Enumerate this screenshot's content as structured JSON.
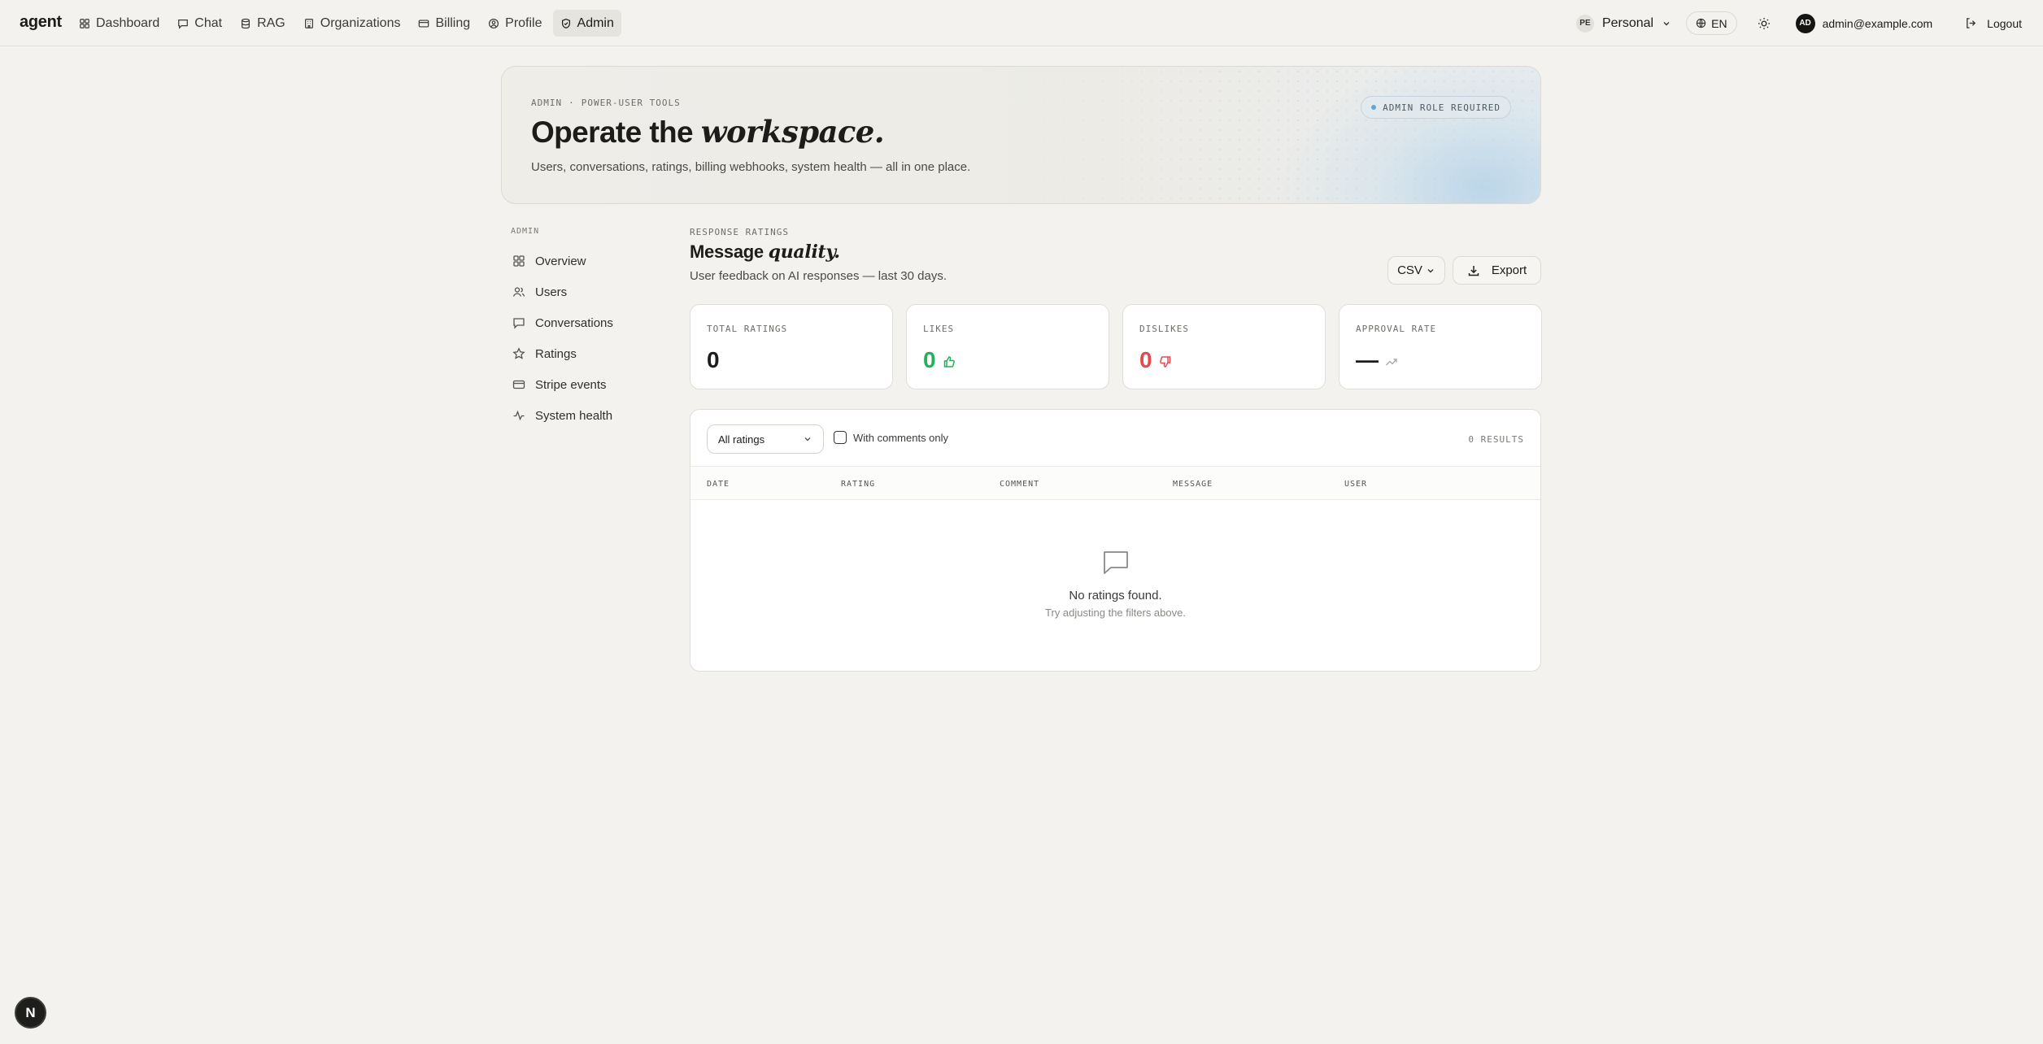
{
  "app": {
    "brand": "agent"
  },
  "nav": {
    "items": [
      {
        "label": "Dashboard",
        "icon": "dashboard-icon"
      },
      {
        "label": "Chat",
        "icon": "chat-icon"
      },
      {
        "label": "RAG",
        "icon": "database-icon"
      },
      {
        "label": "Organizations",
        "icon": "building-icon"
      },
      {
        "label": "Billing",
        "icon": "card-icon"
      },
      {
        "label": "Profile",
        "icon": "user-circle-icon"
      },
      {
        "label": "Admin",
        "icon": "shield-icon",
        "active": true
      }
    ],
    "org": {
      "initials": "PE",
      "name": "Personal"
    },
    "language": "EN",
    "user": {
      "initials": "AD",
      "email": "admin@example.com"
    },
    "logout_label": "Logout"
  },
  "hero": {
    "eyebrow_a": "ADMIN",
    "eyebrow_sep": "·",
    "eyebrow_b": "POWER-USER TOOLS",
    "title_plain": "Operate the ",
    "title_em": "workspace.",
    "subtitle": "Users, conversations, ratings, billing webhooks, system health — all in one place.",
    "badge": "ADMIN ROLE REQUIRED"
  },
  "sidebar": {
    "label": "ADMIN",
    "items": [
      {
        "label": "Overview",
        "icon": "grid-icon"
      },
      {
        "label": "Users",
        "icon": "users-icon"
      },
      {
        "label": "Conversations",
        "icon": "message-icon"
      },
      {
        "label": "Ratings",
        "icon": "star-icon"
      },
      {
        "label": "Stripe events",
        "icon": "card-icon"
      },
      {
        "label": "System health",
        "icon": "activity-icon"
      }
    ]
  },
  "main": {
    "eyebrow": "RESPONSE RATINGS",
    "title_plain": "Message ",
    "title_em": "quality.",
    "subtitle": "User feedback on AI responses — last 30 days.",
    "format_label": "CSV",
    "export_label": "Export",
    "stats": [
      {
        "label": "TOTAL RATINGS",
        "value": "0",
        "color": "#1c1c1a"
      },
      {
        "label": "LIKES",
        "value": "0",
        "color": "#22b05d"
      },
      {
        "label": "DISLIKES",
        "value": "0",
        "color": "#e5484d"
      },
      {
        "label": "APPROVAL RATE",
        "value": "—",
        "color": "#1c1c1a"
      }
    ],
    "filter": {
      "selected": "All ratings",
      "checkbox_label": "With comments only",
      "results": "0 RESULTS"
    },
    "columns": [
      "DATE",
      "RATING",
      "COMMENT",
      "MESSAGE",
      "USER"
    ],
    "empty": {
      "title": "No ratings found.",
      "subtitle": "Try adjusting the filters above."
    }
  },
  "dev_badge": "N"
}
